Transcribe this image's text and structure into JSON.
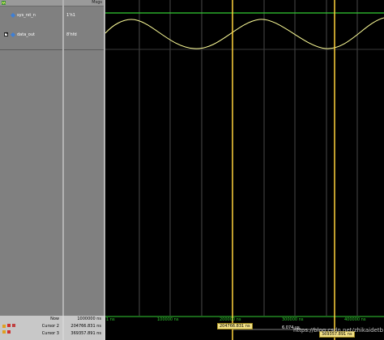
{
  "header": {
    "msgs_label": "Msgs"
  },
  "signals": [
    {
      "name": "sys_rst_n",
      "value": "1'h1"
    },
    {
      "name": "data_out",
      "value": "8'hfd"
    }
  ],
  "timeline": {
    "tick_labels": [
      "1 ns",
      "100000 ns",
      "200000 ns",
      "300000 ns",
      "400000 ns"
    ]
  },
  "status": {
    "now": {
      "label": "Now",
      "value": "1000000 ns"
    },
    "cursor2": {
      "label": "Cursor 2",
      "value": "204766.831 ns",
      "flag": "204766.831 ns"
    },
    "cursor3": {
      "label": "Cursor 3",
      "value": "369357.891 ns",
      "flag": "369357.891 ns"
    },
    "delta": "6.074 us"
  },
  "watermark": "https://blog.csdn.net/zhikaidetb",
  "colors": {
    "waveform": "#ffff99",
    "cursor": "#ffd23c",
    "reset_signal": "#33cc33",
    "grid": "#4a4a4a"
  },
  "icons": {
    "header": "wave-icon",
    "signal": "signal-diamond-icon",
    "expand": "plus-expand-icon"
  }
}
